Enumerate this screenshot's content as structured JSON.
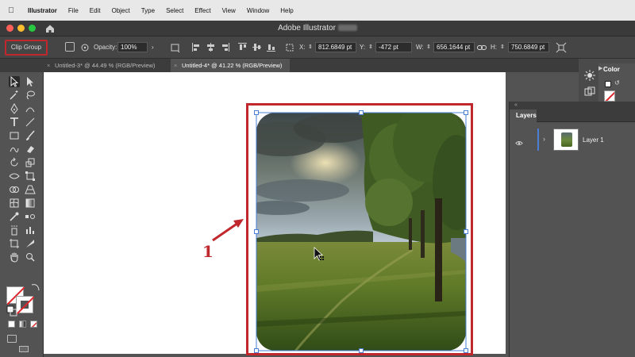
{
  "menubar": {
    "app": "Illustrator",
    "items": [
      "File",
      "Edit",
      "Object",
      "Type",
      "Select",
      "Effect",
      "View",
      "Window",
      "Help"
    ]
  },
  "titlebar": {
    "title": "Adobe Illustrator"
  },
  "control_bar": {
    "selection_label": "Clip Group",
    "opacity_label": "Opacity:",
    "opacity_value": "100%",
    "x_label": "X:",
    "x_value": "812.6849 pt",
    "y_label": "Y:",
    "y_value": "-472 pt",
    "w_label": "W:",
    "w_value": "656.1644 pt",
    "h_label": "H:",
    "h_value": "750.6849 pt"
  },
  "tabs": [
    {
      "label": "Untitled-3* @ 44.49 % (RGB/Preview)",
      "active": false
    },
    {
      "label": "Untitled-4* @ 41.22 % (RGB/Preview)",
      "active": true
    }
  ],
  "annotation": {
    "number": "1",
    "color": "#c0282e"
  },
  "layers_panel": {
    "title": "Layers",
    "layers": [
      {
        "name": "Layer 1",
        "visible": true
      }
    ]
  },
  "color_panel": {
    "title": "Color"
  },
  "colors": {
    "accent_red": "#c0282e",
    "layer_selection": "#4a7fd4",
    "ui_dark": "#535353"
  }
}
